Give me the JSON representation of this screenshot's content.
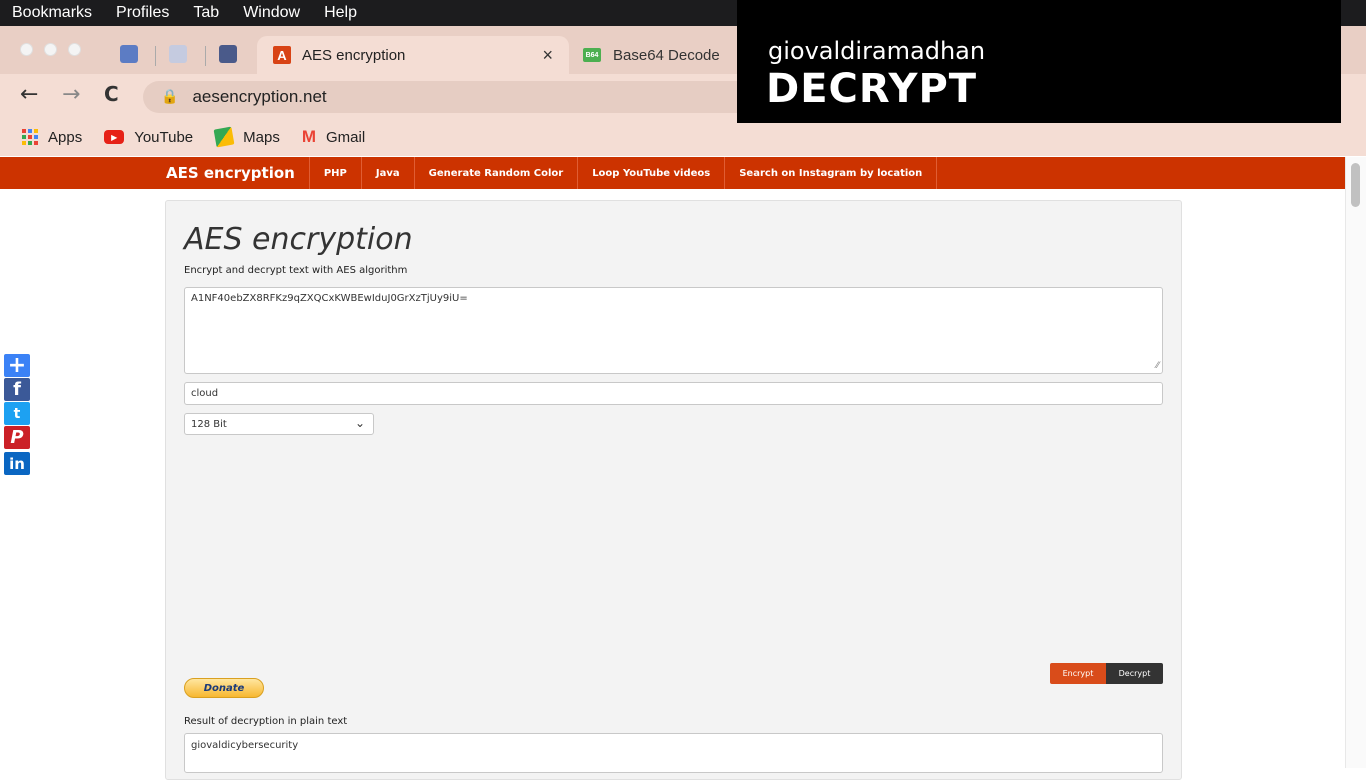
{
  "menubar": {
    "items": [
      "Bookmarks",
      "Profiles",
      "Tab",
      "Window",
      "Help"
    ]
  },
  "tabs": {
    "active": {
      "favicon": "A",
      "title": "AES encryption",
      "close": "×"
    },
    "second": {
      "favicon": "B64",
      "title": "Base64 Decode"
    }
  },
  "toolbar": {
    "url": "aesencryption.net",
    "back": "←",
    "forward": "→",
    "reload": "C",
    "lock": "🔒"
  },
  "bookmarks": [
    {
      "label": "Apps",
      "icon": "apps-grid-icon"
    },
    {
      "label": "YouTube",
      "icon": "youtube-icon"
    },
    {
      "label": "Maps",
      "icon": "maps-icon"
    },
    {
      "label": "Gmail",
      "icon": "gmail-icon"
    }
  ],
  "overlay": {
    "top": "giovaldiramadhan",
    "big": "DECRYPT"
  },
  "sitenav": {
    "brand": "AES encryption",
    "links": [
      "PHP",
      "Java",
      "Generate Random Color",
      "Loop YouTube videos",
      "Search on Instagram by location"
    ]
  },
  "main": {
    "title": "AES encryption",
    "subtitle": "Encrypt and decrypt text with AES algorithm",
    "ciphertext": "A1NF40ebZX8RFKz9qZXQCxKWBEwIduJ0GrXzTjUy9iU=",
    "key": "cloud",
    "keysize": "128 Bit",
    "encrypt_label": "Encrypt",
    "decrypt_label": "Decrypt",
    "donate_label": "Donate",
    "result_label": "Result of decryption in plain text",
    "result_value": "giovaldicybersecurity"
  },
  "share": {
    "plus": "+",
    "facebook": "f",
    "twitter": "t",
    "pinterest": "P",
    "linkedin": "in"
  },
  "colors": {
    "accent": "#cc3300",
    "encrypt": "#d94c1a",
    "decrypt": "#333333"
  }
}
